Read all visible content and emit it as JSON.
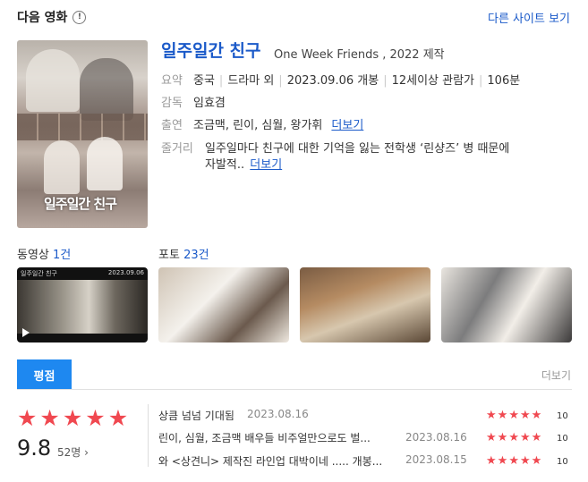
{
  "header": {
    "title": "다음 영화",
    "info_icon": "!",
    "other_sites_link": "다른 사이트 보기"
  },
  "movie": {
    "title_ko": "일주일간 친구",
    "title_en": "One Week Friends , 2022 제작",
    "poster_text": "일주일간 친구",
    "summary_label": "요약",
    "summary": [
      "중국",
      "드라마 외",
      "2023.09.06 개봉",
      "12세이상 관람가",
      "106분"
    ],
    "director_label": "감독",
    "director": "임효겸",
    "cast_label": "출연",
    "cast": "조금맥, 린이, 심월, 왕가휘",
    "cast_more": "더보기",
    "plot_label": "줄거리",
    "plot_line1": "일주일마다 친구에 대한 기억을 잃는 전학생 ‘린샹즈’ 병 때문에",
    "plot_line2": "자발적..",
    "plot_more": "더보기"
  },
  "media": {
    "video_label": "동영상",
    "video_count": "1건",
    "photo_label": "포토",
    "photo_count": "23건",
    "video_thumb_title": "일주일간 친구",
    "video_thumb_date": "2023.09.06"
  },
  "ratings": {
    "tab_label": "평점",
    "more_label": "더보기",
    "score": "9.8",
    "votes": "52명",
    "votes_arrow": "›",
    "star_colors": {
      "filled": "#f04850"
    },
    "reviews": [
      {
        "text": "상큼 넘넘 기대됨",
        "date": "2023.08.16",
        "score": "10"
      },
      {
        "text": "린이, 심월, 조금맥 배우들 비주얼만으로도 벌...",
        "date": "2023.08.16",
        "score": "10"
      },
      {
        "text": "와 <상견니> 제작진 라인업 대박이네 ..... 개봉...",
        "date": "2023.08.15",
        "score": "10"
      }
    ]
  }
}
